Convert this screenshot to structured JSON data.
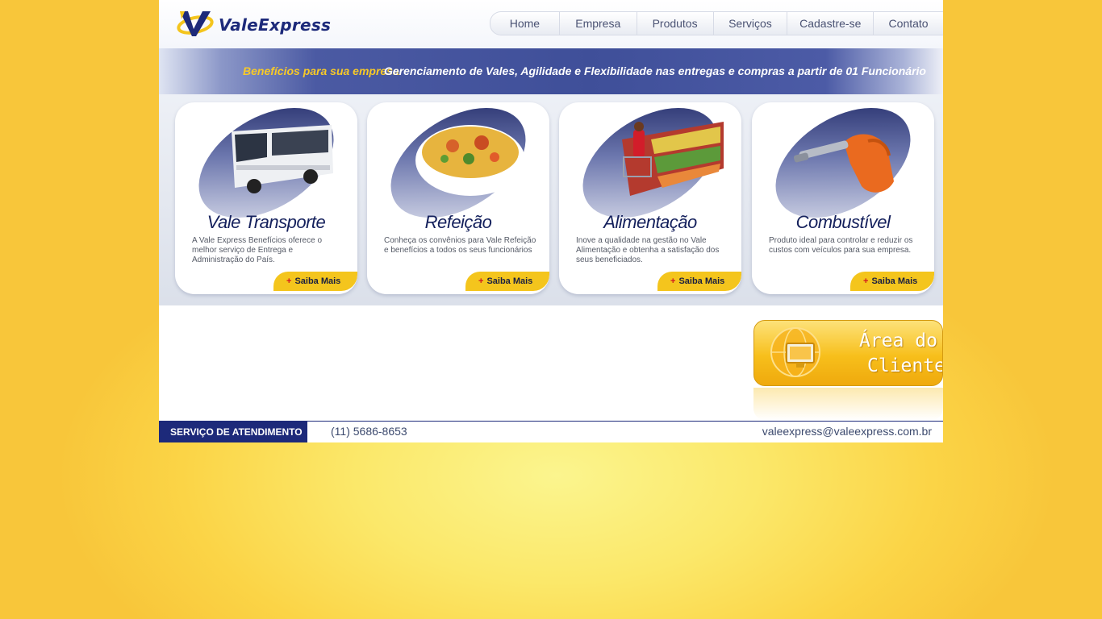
{
  "brand": {
    "name": "ValeExpress",
    "logo_icon": "valeexpress-v-logo",
    "primary": "#1d2a7a",
    "accent": "#f4c51d"
  },
  "nav": [
    {
      "label": "Home"
    },
    {
      "label": "Empresa"
    },
    {
      "label": "Produtos"
    },
    {
      "label": "Serviços"
    },
    {
      "label": "Cadastre-se"
    },
    {
      "label": "Contato"
    }
  ],
  "banner": {
    "tag": "Benefícios para sua empresa",
    "message": "Gerenciamento de Vales, Agilidade e Flexibilidade nas entregas e compras a partir de 01 Funcionário"
  },
  "products": [
    {
      "title": "Vale Transporte",
      "image": "bus-image",
      "description": "A Vale Express Benefícios oferece o melhor serviço de Entrega e Administração do País.",
      "more": "Saiba Mais"
    },
    {
      "title": "Refeição",
      "image": "meal-bowl-image",
      "description": "Conheça os convênios para Vale Refeição e benefícios a todos os seus funcionários",
      "more": "Saiba Mais"
    },
    {
      "title": "Alimentação",
      "image": "supermarket-image",
      "description": "Inove a qualidade na gestão no Vale Alimentação e obtenha a satisfação dos seus beneficiados.",
      "more": "Saiba Mais"
    },
    {
      "title": "Combustível",
      "image": "fuel-nozzle-image",
      "description": "Produto ideal para controlar e reduzir os custos com veículos para sua empresa.",
      "more": "Saiba Mais"
    }
  ],
  "client_area": {
    "line1": "Área do",
    "line2": "Cliente",
    "icon": "globe-monitor-icon"
  },
  "footer": {
    "service_label": "SERVIÇO DE ATENDIMENTO",
    "phone": "(11) 5686-8653",
    "email": "valeexpress@valeexpress.com.br"
  }
}
